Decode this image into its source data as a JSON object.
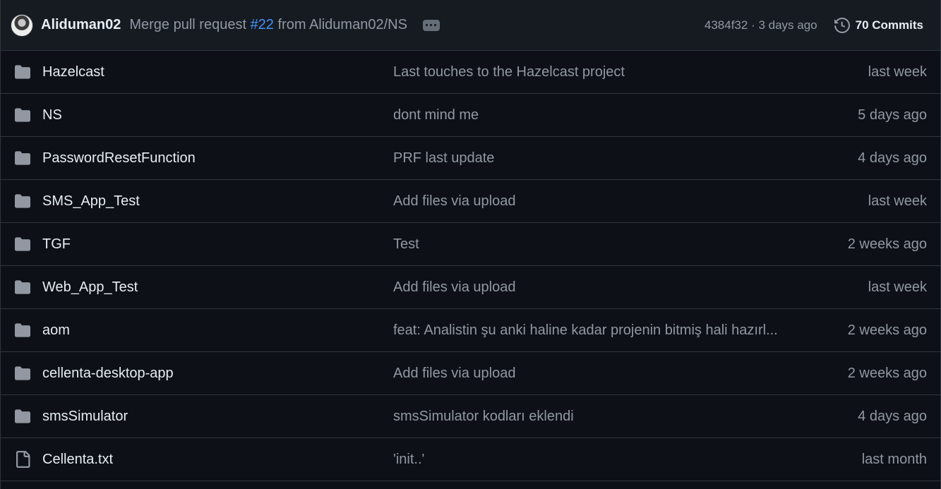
{
  "latest_commit": {
    "author": "Aliduman02",
    "message_prefix": "Merge pull request ",
    "pr_number": "#22",
    "message_suffix": " from Aliduman02/NS",
    "meta": "4384f32 · 3 days ago",
    "commits_label": "70 Commits"
  },
  "icons": {
    "folder": "folder-icon",
    "file": "file-icon",
    "history": "history-icon",
    "ellipsis": "ellipsis-icon"
  },
  "colors": {
    "background": "#0d1117",
    "header_background": "#161b22",
    "border": "#30363d",
    "text_primary": "#e6edf3",
    "text_muted": "#9198a1",
    "link": "#4493f8",
    "folder_icon": "#9198a1"
  },
  "files": [
    {
      "type": "folder",
      "name": "Hazelcast",
      "message": "Last touches to the Hazelcast project",
      "time": "last week"
    },
    {
      "type": "folder",
      "name": "NS",
      "message": "dont mind me",
      "time": "5 days ago"
    },
    {
      "type": "folder",
      "name": "PasswordResetFunction",
      "message": "PRF last update",
      "time": "4 days ago"
    },
    {
      "type": "folder",
      "name": "SMS_App_Test",
      "message": "Add files via upload",
      "time": "last week"
    },
    {
      "type": "folder",
      "name": "TGF",
      "message": "Test",
      "time": "2 weeks ago"
    },
    {
      "type": "folder",
      "name": "Web_App_Test",
      "message": "Add files via upload",
      "time": "last week"
    },
    {
      "type": "folder",
      "name": "aom",
      "message": "feat: Analistin şu anki haline kadar projenin bitmiş hali hazırl...",
      "time": "2 weeks ago"
    },
    {
      "type": "folder",
      "name": "cellenta-desktop-app",
      "message": "Add files via upload",
      "time": "2 weeks ago"
    },
    {
      "type": "folder",
      "name": "smsSimulator",
      "message": "smsSimulator kodları eklendi",
      "time": "4 days ago"
    },
    {
      "type": "file",
      "name": "Cellenta.txt",
      "message": "'init..'",
      "time": "last month"
    }
  ]
}
